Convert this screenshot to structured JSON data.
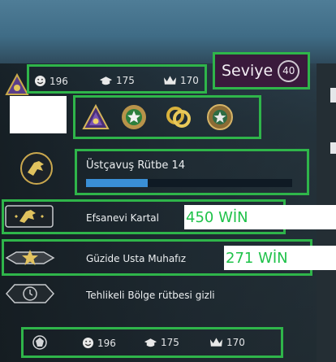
{
  "top_stats": {
    "smiles": "196",
    "teacher": "175",
    "leader": "170"
  },
  "level": {
    "label": "Seviye",
    "value": "40"
  },
  "rank": {
    "name": "Üstçavuş Rütbe 14",
    "progress": 0.3
  },
  "ranks": [
    {
      "label": "Efsanevi Kartal",
      "wins": "450 WİN"
    },
    {
      "label": "Güzide Usta Muhafız",
      "wins": "271 WİN"
    },
    {
      "label": "Tehlikeli Bölge rütbesi gizli"
    }
  ],
  "bottom_stats": {
    "smiles": "196",
    "teacher": "175",
    "leader": "170"
  },
  "icons": [
    "triangle-medal-icon",
    "star-green-medal-icon",
    "rings-coin-icon",
    "star-rosette-medal-icon"
  ],
  "colors": {
    "highlight": "#2fb54a",
    "win_text": "#1fc24a",
    "progress": "#3a8fd6",
    "level_bg": "#3a1a3c"
  }
}
